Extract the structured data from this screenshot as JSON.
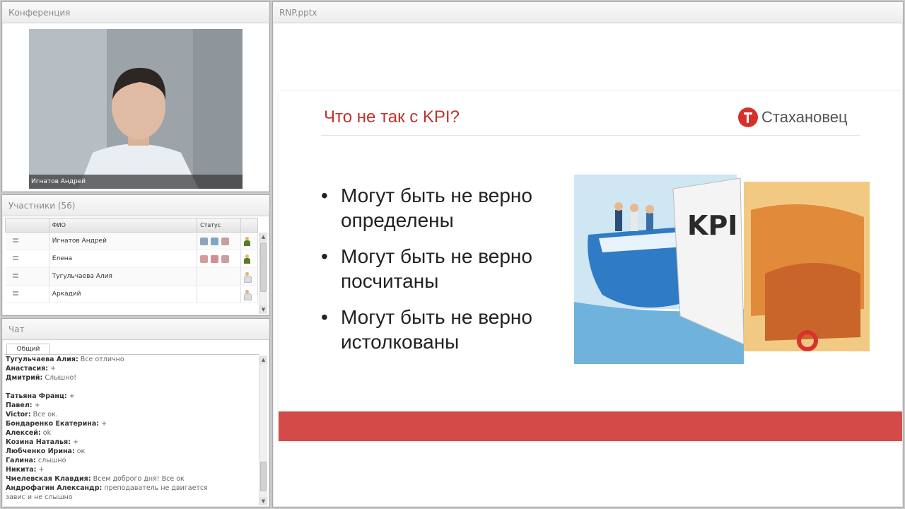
{
  "conference": {
    "title": "Конференция",
    "speaker_name": "Игнатов Андрей"
  },
  "participants": {
    "title": "Участники (56)",
    "columns": {
      "menu": "",
      "name": "ФИО",
      "status": "Статус"
    },
    "rows": [
      {
        "name": "Игнатов Андрей"
      },
      {
        "name": "Елена"
      },
      {
        "name": "Тугульчаева Алия"
      },
      {
        "name": "Аркадий"
      }
    ]
  },
  "chat": {
    "title": "Чат",
    "tab": "Общий",
    "messages": [
      {
        "author": "Тугульчаева Алия:",
        "text": "Все отлично"
      },
      {
        "author": "Анастасия:",
        "text": "+"
      },
      {
        "author": "Дмитрий:",
        "text": "Слышно!"
      },
      {
        "author": "",
        "text": ""
      },
      {
        "author": "Татьяна Франц:",
        "text": "+"
      },
      {
        "author": "Павел:",
        "text": "+"
      },
      {
        "author": "Victor:",
        "text": "Все ок."
      },
      {
        "author": "Бондаренко Екатерина:",
        "text": "+"
      },
      {
        "author": "Алексей:",
        "text": "ok"
      },
      {
        "author": "Козина Наталья:",
        "text": "+"
      },
      {
        "author": "Любченко Ирина:",
        "text": "ок"
      },
      {
        "author": "Галина:",
        "text": "слышно"
      },
      {
        "author": "Никита:",
        "text": "+"
      },
      {
        "author": "Чмелевская Клавдия:",
        "text": "Всем доброго дня! Все ок"
      },
      {
        "author": "Андрофагин Александр:",
        "text": "преподаватель не двигается"
      },
      {
        "author": "",
        "text": "завис и не слышно"
      }
    ]
  },
  "presentation": {
    "file_name": "RNP.pptx",
    "slide": {
      "title": "Что не так с KPI?",
      "logo_text": "Стахановец",
      "bullets": [
        "Могут быть не верно определены",
        "Могут быть не верно посчитаны",
        "Могут быть не верно истолкованы"
      ],
      "illustration_label": "KPI"
    }
  },
  "colors": {
    "accent_red": "#d44a48",
    "title_red": "#c0322e"
  }
}
